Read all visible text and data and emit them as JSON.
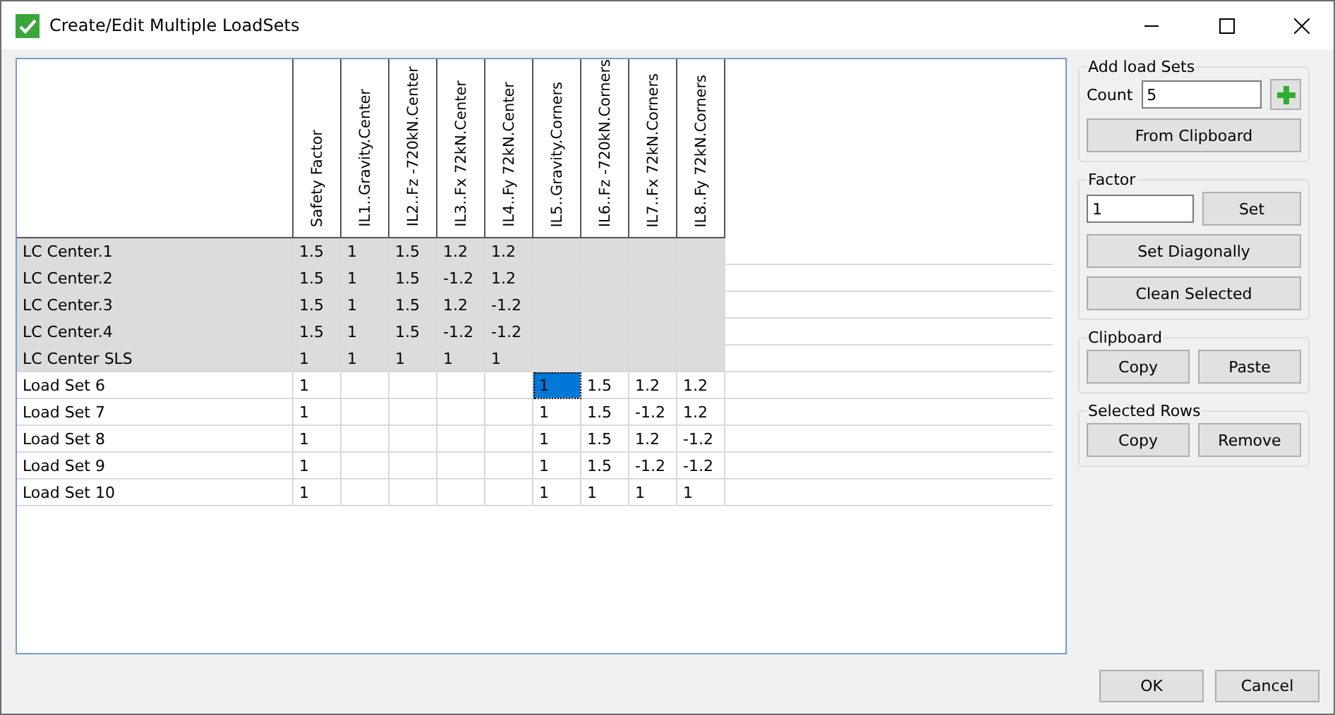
{
  "window": {
    "title": "Create/Edit Multiple LoadSets"
  },
  "grid": {
    "columns": [
      "Safety Factor",
      "IL1..Gravity.Center",
      "IL2..Fz -720kN.Center",
      "IL3..Fx 72kN.Center",
      "IL4..Fy 72kN.Center",
      "IL5..Gravity.Corners",
      "IL6..Fz -720kN.Corners",
      "IL7..Fx 72kN.Corners",
      "IL8..Fy 72kN.Corners"
    ],
    "rows": [
      {
        "name": "LC Center.1",
        "shaded": true,
        "cells": [
          {
            "text": "1.5",
            "selected": false
          },
          {
            "text": "1",
            "selected": false
          },
          {
            "text": "1.5",
            "selected": false
          },
          {
            "text": "1.2",
            "selected": false
          },
          {
            "text": "1.2",
            "selected": false
          },
          {
            "selected": false
          },
          {
            "selected": false
          },
          {
            "selected": false
          },
          {
            "selected": false
          }
        ]
      },
      {
        "name": "LC Center.2",
        "shaded": true,
        "cells": [
          {
            "text": "1.5",
            "selected": false
          },
          {
            "text": "1",
            "selected": false
          },
          {
            "text": "1.5",
            "selected": false
          },
          {
            "text": "-1.2",
            "selected": false
          },
          {
            "text": "1.2",
            "selected": false
          },
          {
            "selected": false
          },
          {
            "selected": false
          },
          {
            "selected": false
          },
          {
            "selected": false
          }
        ]
      },
      {
        "name": "LC Center.3",
        "shaded": true,
        "cells": [
          {
            "text": "1.5",
            "selected": false
          },
          {
            "text": "1",
            "selected": false
          },
          {
            "text": "1.5",
            "selected": false
          },
          {
            "text": "1.2",
            "selected": false
          },
          {
            "text": "-1.2",
            "selected": false
          },
          {
            "selected": false
          },
          {
            "selected": false
          },
          {
            "selected": false
          },
          {
            "selected": false
          }
        ]
      },
      {
        "name": "LC Center.4",
        "shaded": true,
        "cells": [
          {
            "text": "1.5",
            "selected": false
          },
          {
            "text": "1",
            "selected": false
          },
          {
            "text": "1.5",
            "selected": false
          },
          {
            "text": "-1.2",
            "selected": false
          },
          {
            "text": "-1.2",
            "selected": false
          },
          {
            "selected": false
          },
          {
            "selected": false
          },
          {
            "selected": false
          },
          {
            "selected": false
          }
        ]
      },
      {
        "name": "LC Center SLS",
        "shaded": true,
        "cells": [
          {
            "text": "1",
            "selected": false
          },
          {
            "text": "1",
            "selected": false
          },
          {
            "text": "1",
            "selected": false
          },
          {
            "text": "1",
            "selected": false
          },
          {
            "text": "1",
            "selected": false
          },
          {
            "selected": false
          },
          {
            "selected": false
          },
          {
            "selected": false
          },
          {
            "selected": false
          }
        ]
      },
      {
        "name": "Load Set 6",
        "shaded": false,
        "cells": [
          {
            "text": "1",
            "selected": false
          },
          {
            "selected": false
          },
          {
            "selected": false
          },
          {
            "selected": false
          },
          {
            "selected": false
          },
          {
            "text": "1",
            "selected": true
          },
          {
            "text": "1.5",
            "selected": false
          },
          {
            "text": "1.2",
            "selected": false
          },
          {
            "text": "1.2",
            "selected": false
          }
        ]
      },
      {
        "name": "Load Set 7",
        "shaded": false,
        "cells": [
          {
            "text": "1",
            "selected": false
          },
          {
            "selected": false
          },
          {
            "selected": false
          },
          {
            "selected": false
          },
          {
            "selected": false
          },
          {
            "text": "1",
            "selected": false
          },
          {
            "text": "1.5",
            "selected": false
          },
          {
            "text": "-1.2",
            "selected": false
          },
          {
            "text": "1.2",
            "selected": false
          }
        ]
      },
      {
        "name": "Load Set 8",
        "shaded": false,
        "cells": [
          {
            "text": "1",
            "selected": false
          },
          {
            "selected": false
          },
          {
            "selected": false
          },
          {
            "selected": false
          },
          {
            "selected": false
          },
          {
            "text": "1",
            "selected": false
          },
          {
            "text": "1.5",
            "selected": false
          },
          {
            "text": "1.2",
            "selected": false
          },
          {
            "text": "-1.2",
            "selected": false
          }
        ]
      },
      {
        "name": "Load Set 9",
        "shaded": false,
        "cells": [
          {
            "text": "1",
            "selected": false
          },
          {
            "selected": false
          },
          {
            "selected": false
          },
          {
            "selected": false
          },
          {
            "selected": false
          },
          {
            "text": "1",
            "selected": false
          },
          {
            "text": "1.5",
            "selected": false
          },
          {
            "text": "-1.2",
            "selected": false
          },
          {
            "text": "-1.2",
            "selected": false
          }
        ]
      },
      {
        "name": "Load Set 10",
        "shaded": false,
        "cells": [
          {
            "text": "1",
            "selected": false
          },
          {
            "selected": false
          },
          {
            "selected": false
          },
          {
            "selected": false
          },
          {
            "selected": false
          },
          {
            "text": "1",
            "selected": false
          },
          {
            "text": "1",
            "selected": false
          },
          {
            "text": "1",
            "selected": false
          },
          {
            "text": "1",
            "selected": false
          }
        ]
      }
    ]
  },
  "add_load_sets": {
    "title": "Add load Sets",
    "count_label": "Count",
    "count_value": "5",
    "from_clipboard": "From Clipboard"
  },
  "factor": {
    "title": "Factor",
    "value": "1",
    "set": "Set",
    "set_diagonally": "Set Diagonally",
    "clean_selected": "Clean Selected"
  },
  "clipboard": {
    "title": "Clipboard",
    "copy": "Copy",
    "paste": "Paste"
  },
  "selected_rows": {
    "title": "Selected Rows",
    "copy": "Copy",
    "remove": "Remove"
  },
  "footer": {
    "ok": "OK",
    "cancel": "Cancel"
  }
}
